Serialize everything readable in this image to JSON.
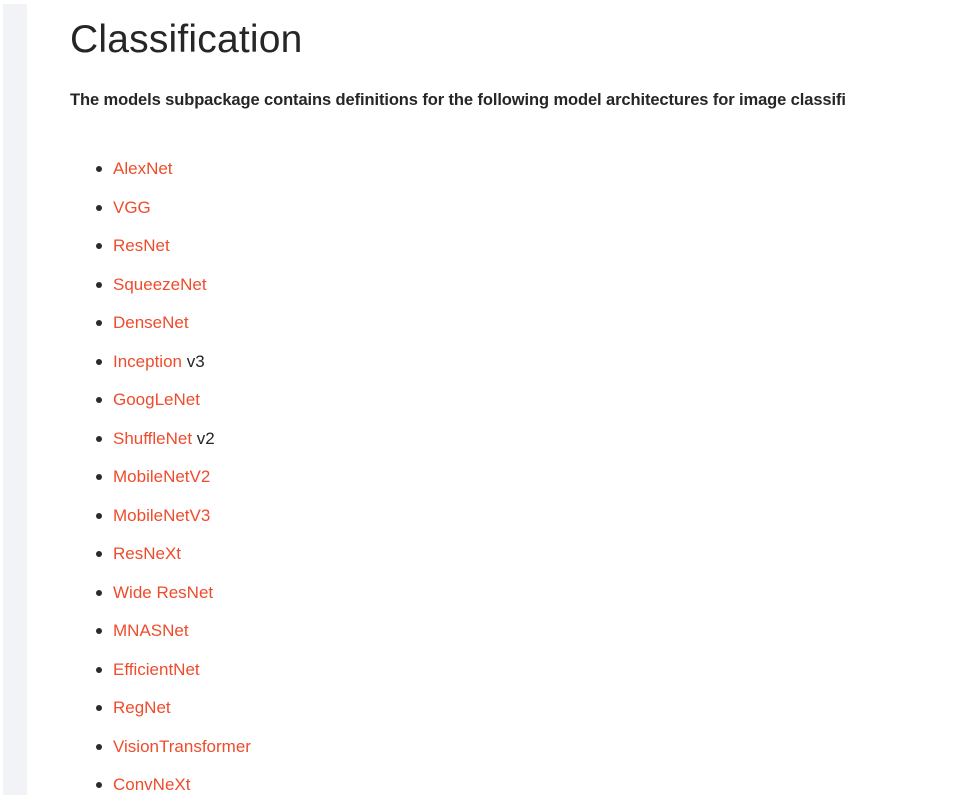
{
  "page": {
    "title": "Classification",
    "intro": "The models subpackage contains definitions for the following model architectures for image classifi",
    "link_color": "#ee4c2c",
    "text_color": "#262626",
    "rail_color": "#f2f3f7",
    "bullet_icon": "bullet-dot"
  },
  "models": [
    {
      "link": "AlexNet",
      "suffix": ""
    },
    {
      "link": "VGG",
      "suffix": ""
    },
    {
      "link": "ResNet",
      "suffix": ""
    },
    {
      "link": "SqueezeNet",
      "suffix": ""
    },
    {
      "link": "DenseNet",
      "suffix": ""
    },
    {
      "link": "Inception",
      "suffix": " v3"
    },
    {
      "link": "GoogLeNet",
      "suffix": ""
    },
    {
      "link": "ShuffleNet",
      "suffix": " v2"
    },
    {
      "link": "MobileNetV2",
      "suffix": ""
    },
    {
      "link": "MobileNetV3",
      "suffix": ""
    },
    {
      "link": "ResNeXt",
      "suffix": ""
    },
    {
      "link": "Wide ResNet",
      "suffix": ""
    },
    {
      "link": "MNASNet",
      "suffix": ""
    },
    {
      "link": "EfficientNet",
      "suffix": ""
    },
    {
      "link": "RegNet",
      "suffix": ""
    },
    {
      "link": "VisionTransformer",
      "suffix": ""
    },
    {
      "link": "ConvNeXt",
      "suffix": ""
    }
  ]
}
